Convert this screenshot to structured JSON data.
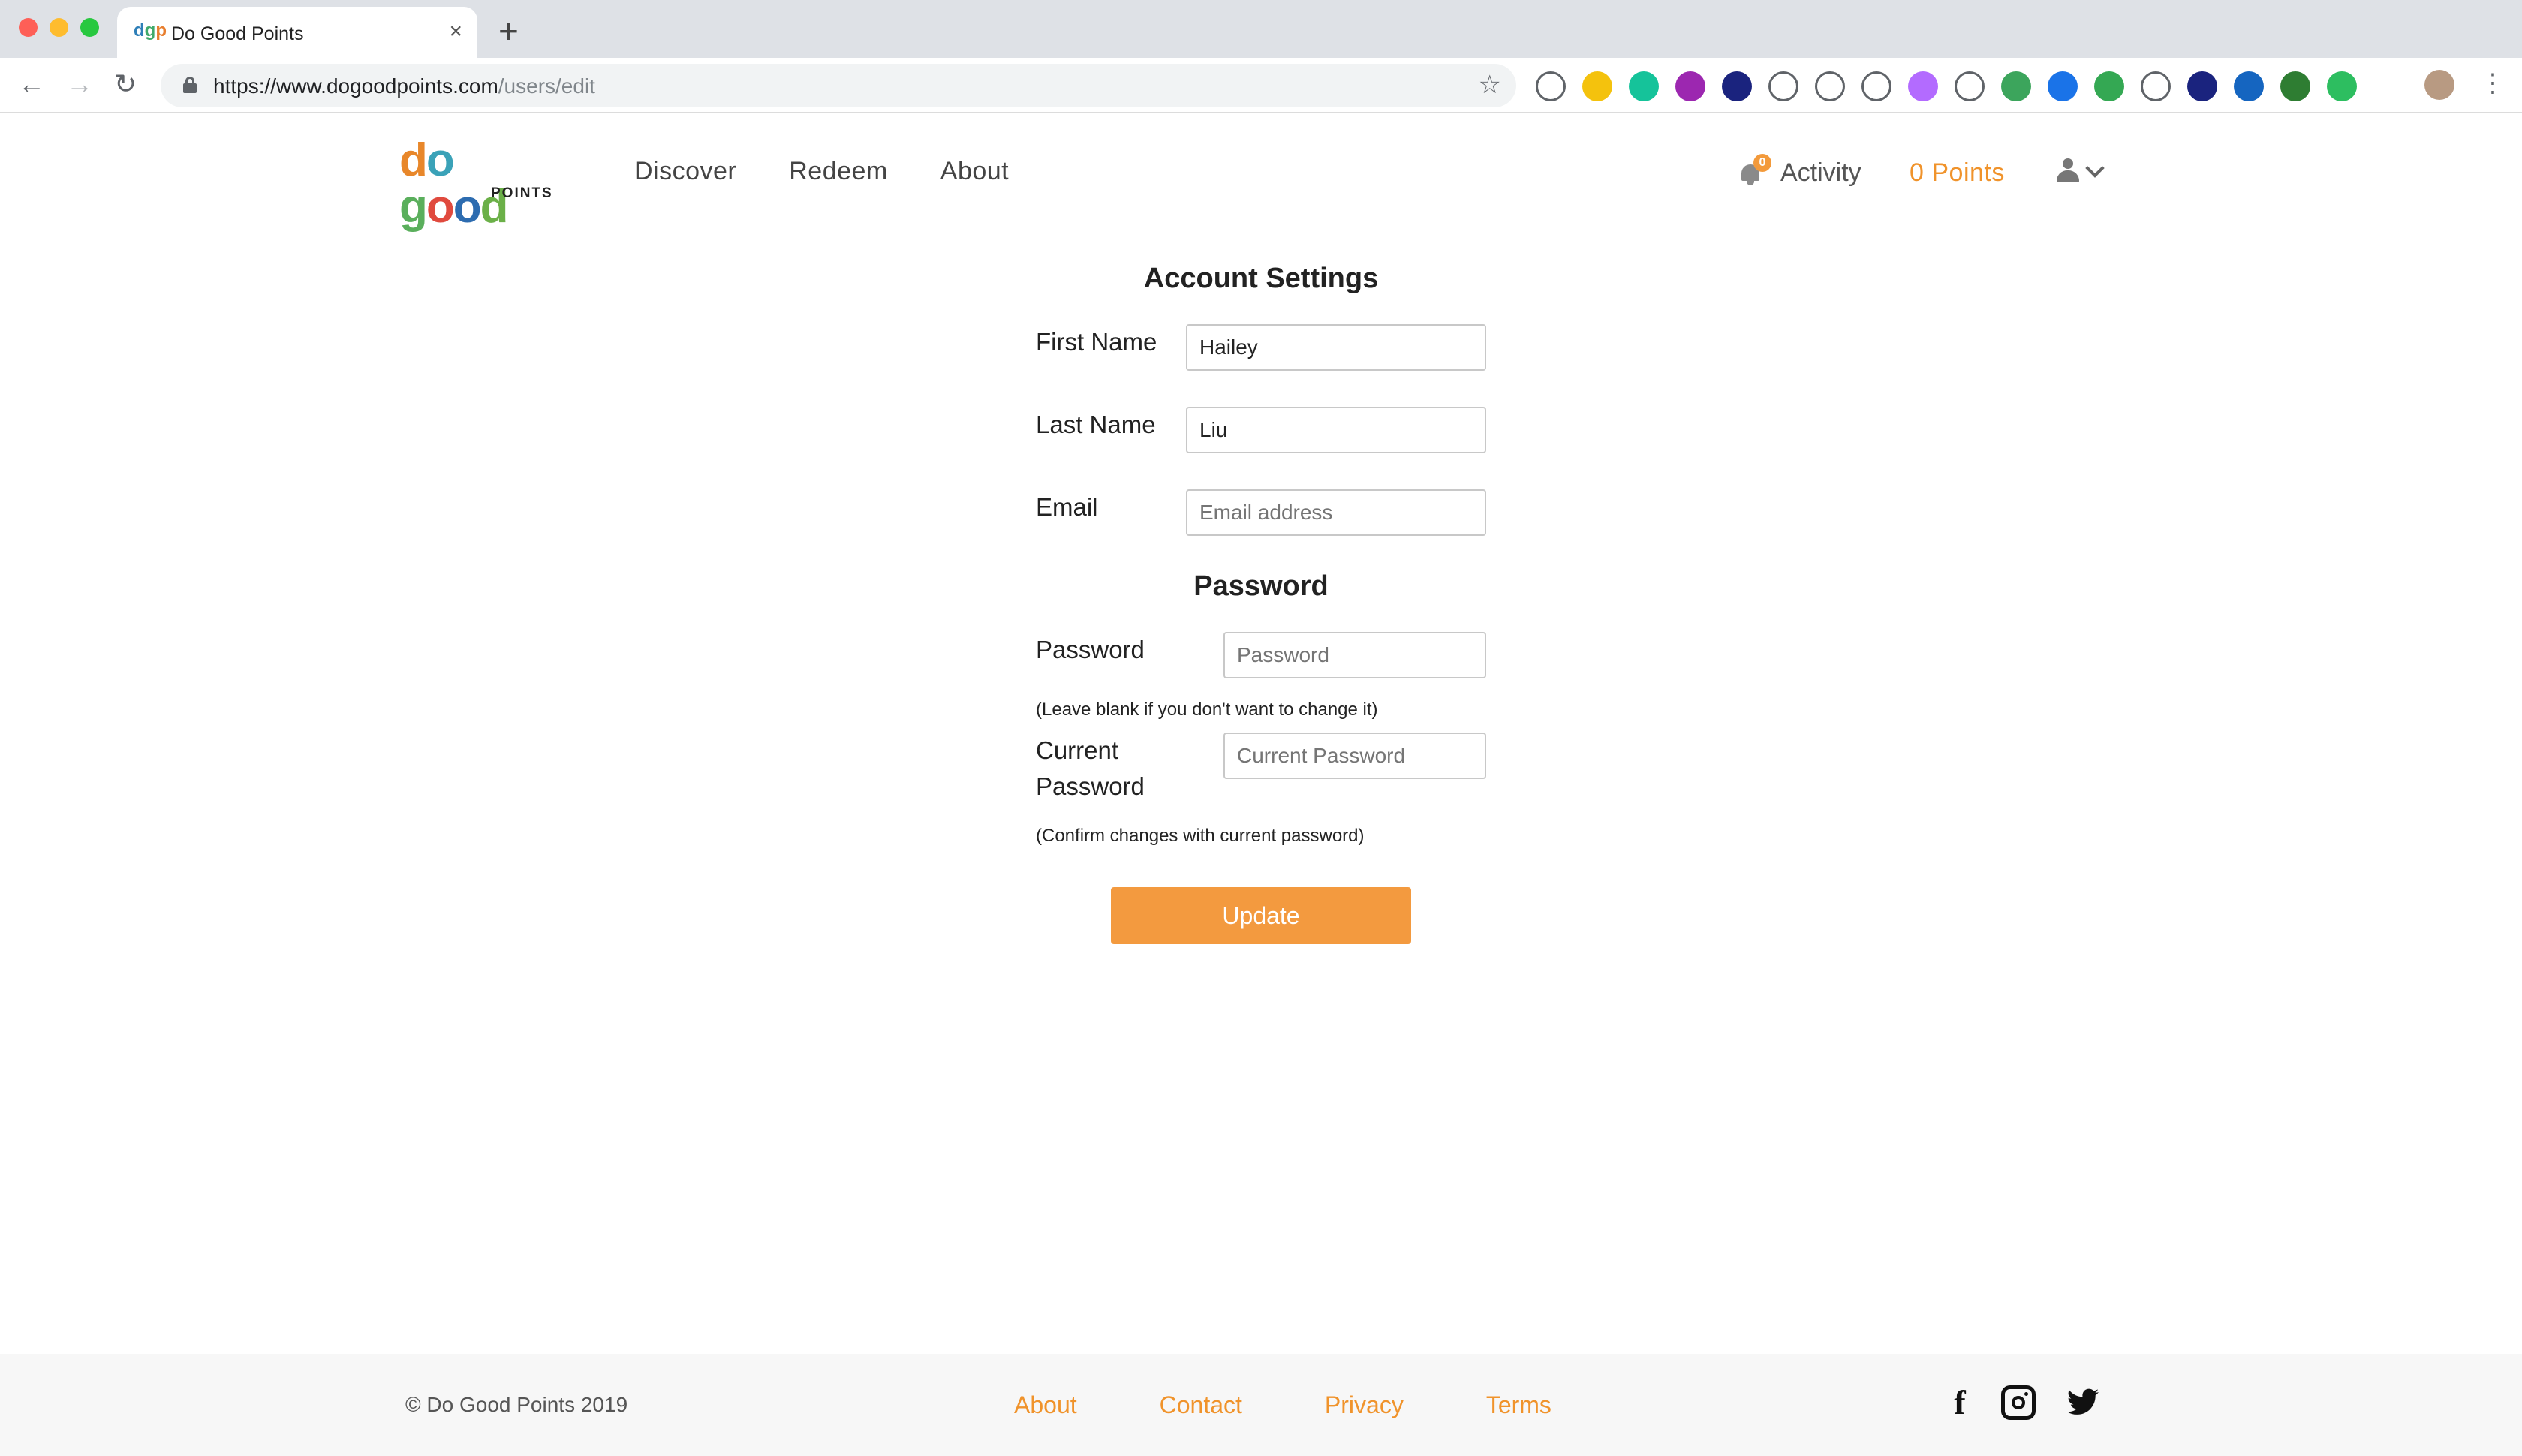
{
  "browser": {
    "tab_title": "Do Good Points",
    "tab_favicon_text": "dgp",
    "url_host": "https://www.dogoodpoints.com",
    "url_path": "/users/edit",
    "extensions": [
      {
        "icon": "chart-ext-icon",
        "color": "#ffffff"
      },
      {
        "icon": "shield-ext-icon",
        "color": "#f4c20d"
      },
      {
        "icon": "grammarly-ext-icon",
        "color": "#15c39a"
      },
      {
        "icon": "e-ext-icon",
        "color": "#9c27b0"
      },
      {
        "icon": "color-ext-icon",
        "color": "#1a237e"
      },
      {
        "icon": "spiral-ext-icon",
        "color": "#ffffff"
      },
      {
        "icon": "bird-ext-icon",
        "color": "#ffffff"
      },
      {
        "icon": "eyedropper-ext-icon",
        "color": "#ffffff"
      },
      {
        "icon": "purple-ext-icon",
        "color": "#b36bff"
      },
      {
        "icon": "new-ext-icon",
        "color": "#ffffff"
      },
      {
        "icon": "recycle-ext-icon",
        "color": "#3ca55c"
      },
      {
        "icon": "info-ext-icon",
        "color": "#1a73e8"
      },
      {
        "icon": "search-ext-icon",
        "color": "#34a853"
      },
      {
        "icon": "camera-ext-icon",
        "color": "#ffffff"
      },
      {
        "icon": "v-ext-icon",
        "color": "#1a237e"
      },
      {
        "icon": "s-ext-icon",
        "color": "#1565c0"
      },
      {
        "icon": "grid-ext-icon",
        "color": "#2e7d32"
      },
      {
        "icon": "evernote-ext-icon",
        "color": "#2dbe60"
      }
    ]
  },
  "header": {
    "logo_top": "do good",
    "logo_sub": "POINTS",
    "nav": [
      "Discover",
      "Redeem",
      "About"
    ],
    "activity_badge": "0",
    "activity_label": "Activity",
    "points_label": "0 Points"
  },
  "form": {
    "heading": "Account Settings",
    "first_name_label": "First Name",
    "first_name_value": "Hailey",
    "last_name_label": "Last Name",
    "last_name_value": "Liu",
    "email_label": "Email",
    "email_placeholder": "Email address",
    "password_heading": "Password",
    "password_label": "Password",
    "password_placeholder": "Password",
    "password_hint": "(Leave blank if you don't want to change it)",
    "current_password_label_1": "Current",
    "current_password_label_2": "Password",
    "current_password_placeholder": "Current Password",
    "current_password_hint": "(Confirm changes with current password)",
    "update_label": "Update"
  },
  "footer": {
    "copyright": "© Do Good Points 2019",
    "links": [
      "About",
      "Contact",
      "Privacy",
      "Terms"
    ],
    "link_color": "#f0932b"
  },
  "colors": {
    "accent": "#f39a3f",
    "points": "#f0932b"
  }
}
